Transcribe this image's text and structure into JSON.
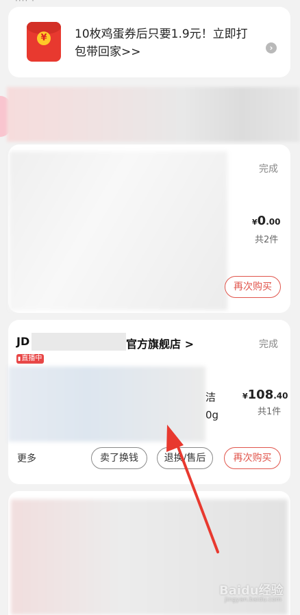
{
  "promo": {
    "text": "10枚鸡蛋券后只要1.9元！立即打包带回家>>",
    "icon": "red-packet-icon",
    "coin_glyph": "¥",
    "arrow_glyph": "›"
  },
  "orders": [
    {
      "status": "完成",
      "price_currency": "¥",
      "price_int": "0",
      "price_dec": ".00",
      "quantity": "共2件",
      "buttons": {
        "rebuy": "再次购买"
      }
    },
    {
      "shop_prefix": "JD",
      "shop_suffix": "官方旗舰店 >",
      "live_tag": "直播中",
      "status": "完成",
      "product_text_1": "洁",
      "product_text_2": "0g",
      "price_currency": "¥",
      "price_int": "108",
      "price_dec": ".40",
      "quantity": "共1件",
      "more": "更多",
      "buttons": {
        "sell": "卖了换钱",
        "refund": "退换/售后",
        "rebuy": "再次购买"
      }
    }
  ],
  "watermark": {
    "main": "Baidu经验",
    "sub": "jingyan.baidu.com"
  },
  "colors": {
    "accent": "#e0534a",
    "live": "#e84545",
    "arrow": "#e8392f"
  }
}
